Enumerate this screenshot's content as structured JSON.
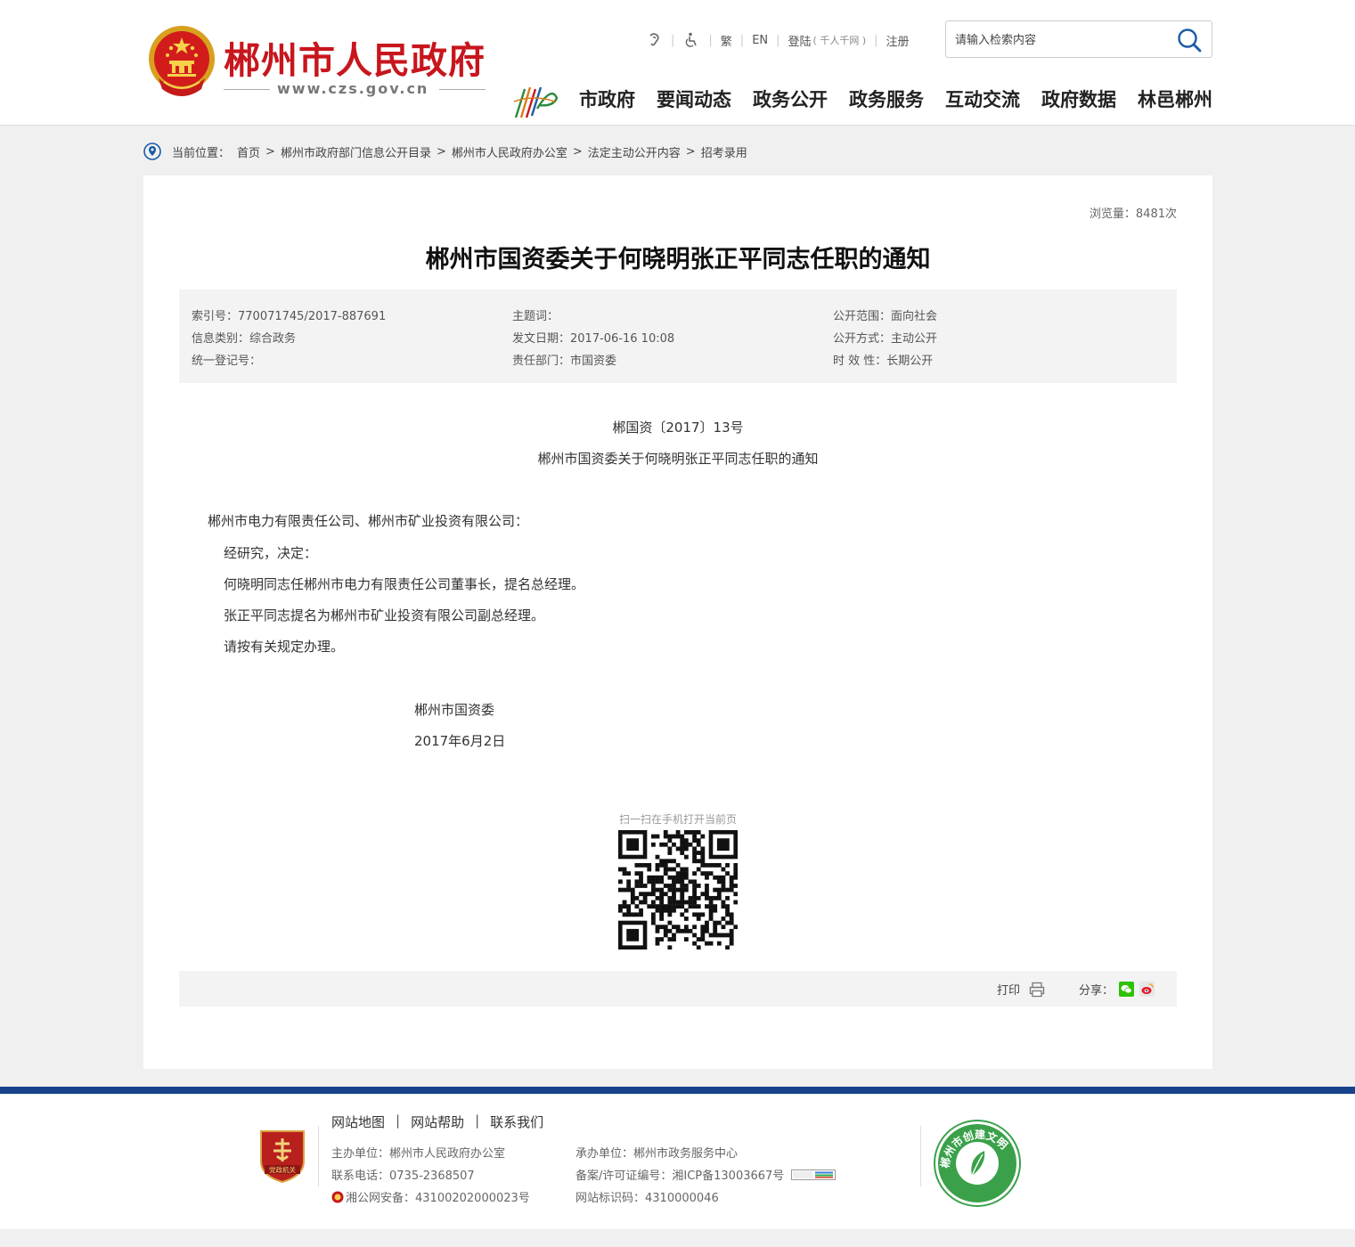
{
  "header": {
    "site_name": "郴州市人民政府",
    "site_url": "www.czs.gov.cn",
    "toplinks": {
      "traditional": "繁",
      "english": "EN",
      "login": "登陆",
      "login_sub": "( 千人千网 )",
      "register": "注册"
    },
    "search_placeholder": "请输入检索内容",
    "nav": [
      "市政府",
      "要闻动态",
      "政务公开",
      "政务服务",
      "互动交流",
      "政府数据",
      "林邑郴州"
    ]
  },
  "breadcrumb": {
    "label": "当前位置：",
    "items": [
      "首页",
      "郴州市政府部门信息公开目录",
      "郴州市人民政府办公室",
      "法定主动公开内容",
      "招考录用"
    ]
  },
  "article": {
    "views": "浏览量：8481次",
    "title": "郴州市国资委关于何晓明张正平同志任职的通知",
    "meta": {
      "index_no": "索引号：770071745/2017-887691",
      "category": "信息类别：综合政务",
      "reg_no": "统一登记号：",
      "subject": "主题词：",
      "issue_date": "发文日期：2017-06-16 10:08",
      "department": "责任部门：市国资委",
      "scope": "公开范围：面向社会",
      "method": "公开方式：主动公开",
      "validity": "时 效 性：长期公开"
    },
    "doc_number": "郴国资〔2017〕13号",
    "doc_subtitle": "郴州市国资委关于何晓明张正平同志任职的通知",
    "recipients": "郴州市电力有限责任公司、郴州市矿业投资有限公司：",
    "paragraphs": [
      "经研究，决定：",
      "何晓明同志任郴州市电力有限责任公司董事长，提名总经理。",
      "张正平同志提名为郴州市矿业投资有限公司副总经理。",
      "请按有关规定办理。"
    ],
    "signature": "郴州市国资委",
    "sign_date": "2017年6月2日",
    "qr_caption": "扫一扫在手机打开当前页",
    "print_label": "打印",
    "share_label": "分享："
  },
  "footer": {
    "links": [
      "网站地图",
      "网站帮助",
      "联系我们"
    ],
    "sponsor": "主办单位：郴州市人民政府办公室",
    "phone": "联系电话：0735-2368507",
    "police": "湘公网安备：43100202000023号",
    "undertaker": "承办单位：郴州市政务服务中心",
    "icp": "备案/许可证编号：湘ICP备13003667号",
    "site_code": "网站标识码：4310000046",
    "badge_text": "党政机关",
    "civil_text": "郴州市创建文明网站"
  },
  "colors": {
    "brand_red": "#c8161d",
    "footer_blue": "#15428b",
    "accent_blue": "#1a5aa8"
  }
}
